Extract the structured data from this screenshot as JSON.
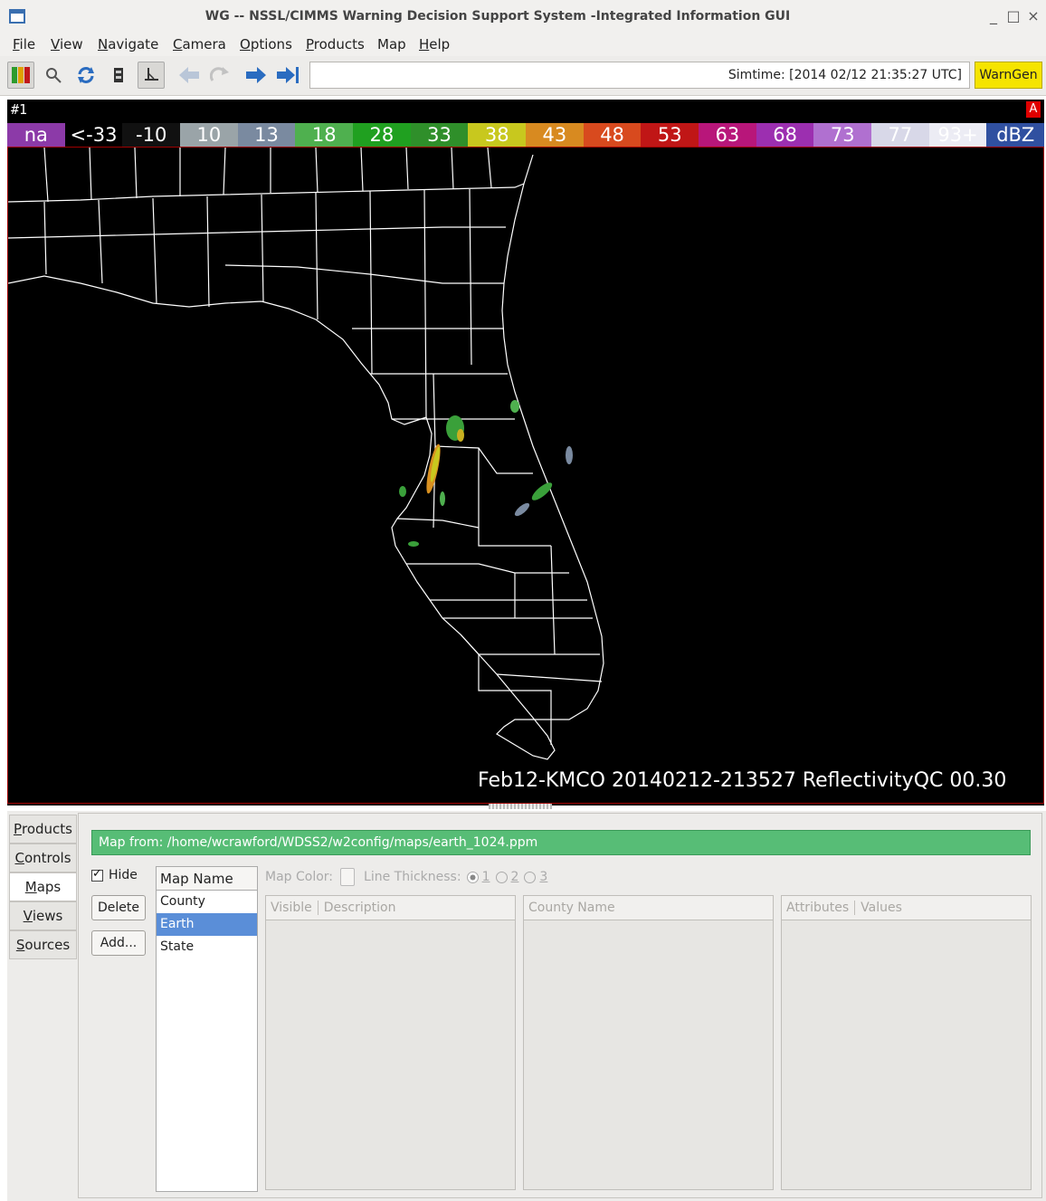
{
  "window": {
    "title": "WG -- NSSL/CIMMS Warning Decision Support System -Integrated Information GUI",
    "controls": [
      "_",
      "□",
      "×"
    ]
  },
  "menubar": [
    {
      "label": "File",
      "u": "F",
      "rest": "ile"
    },
    {
      "label": "View",
      "u": "V",
      "rest": "iew"
    },
    {
      "label": "Navigate",
      "u": "N",
      "rest": "avigate"
    },
    {
      "label": "Camera",
      "u": "C",
      "rest": "amera"
    },
    {
      "label": "Options",
      "u": "O",
      "rest": "ptions"
    },
    {
      "label": "Products",
      "u": "P",
      "rest": "roducts"
    },
    {
      "label": "Map",
      "u": "",
      "rest": "Map"
    },
    {
      "label": "Help",
      "u": "H",
      "rest": "elp"
    }
  ],
  "toolbar": {
    "icons": [
      "color-map-icon",
      "magnifier-icon",
      "refresh-icon",
      "lock-icon",
      "probe-icon",
      "back-icon",
      "redo-icon",
      "forward-icon",
      "latest-icon"
    ],
    "simtime": "Simtime: [2014 02/12 21:35:27 UTC]",
    "warngen": "WarnGen"
  },
  "display": {
    "pane_label": "#1",
    "pane_flag": "A",
    "overlay_text": "Feb12-KMCO 20140212-213527 ReflectivityQC 00.30"
  },
  "colorbar": [
    {
      "label": "na",
      "color": "#8c3aa8"
    },
    {
      "label": "<-33",
      "color": "#000000"
    },
    {
      "label": "-10",
      "color": "#111111"
    },
    {
      "label": "10",
      "color": "#9aa4a8"
    },
    {
      "label": "13",
      "color": "#7a8aa0"
    },
    {
      "label": "18",
      "color": "#4fb04f"
    },
    {
      "label": "28",
      "color": "#20a020"
    },
    {
      "label": "33",
      "color": "#2f8f2a"
    },
    {
      "label": "38",
      "color": "#c8c81e"
    },
    {
      "label": "43",
      "color": "#d88a20"
    },
    {
      "label": "48",
      "color": "#d84a1e"
    },
    {
      "label": "53",
      "color": "#c01616"
    },
    {
      "label": "63",
      "color": "#b8167a"
    },
    {
      "label": "68",
      "color": "#9c2fb0"
    },
    {
      "label": "73",
      "color": "#b070d0"
    },
    {
      "label": "77",
      "color": "#d8d8e8"
    },
    {
      "label": "93+",
      "color": "#ececf4"
    },
    {
      "label": "dBZ",
      "color": "#3050a0"
    }
  ],
  "side_tabs": [
    {
      "u": "P",
      "rest": "roducts",
      "active": false
    },
    {
      "u": "C",
      "rest": "ontrols",
      "active": false
    },
    {
      "u": "M",
      "rest": "aps",
      "active": true
    },
    {
      "u": "V",
      "rest": "iews",
      "active": false
    },
    {
      "u": "S",
      "rest": "ources",
      "active": false
    }
  ],
  "maps_panel": {
    "status": "Map from: /home/wcrawford/WDSS2/w2config/maps/earth_1024.ppm",
    "hide_label": "Hide",
    "delete_label": "Delete",
    "add_label": "Add...",
    "map_list_header": "Map Name",
    "map_items": [
      "County",
      "Earth",
      "State"
    ],
    "selected_index": 1,
    "map_color_label": "Map Color:",
    "line_thickness_label": "Line Thickness:",
    "thickness_options": [
      "1",
      "2",
      "3"
    ],
    "table_headers": {
      "visible": "Visible",
      "description": "Description",
      "county_name": "County Name",
      "attributes": "Attributes",
      "values": "Values"
    }
  }
}
